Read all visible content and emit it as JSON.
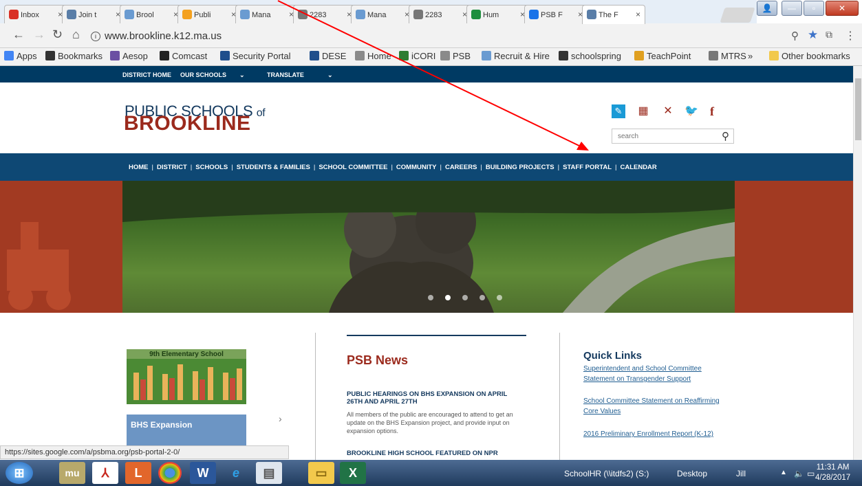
{
  "browser": {
    "tabs": [
      {
        "label": "Inbox",
        "icon": "gmail-icon",
        "color": "#d93025"
      },
      {
        "label": "Join t",
        "icon": "globe-icon",
        "color": "#5a7ea8"
      },
      {
        "label": "Brool",
        "icon": "globe-icon",
        "color": "#6a9bd1"
      },
      {
        "label": "Publi",
        "icon": "star-icon",
        "color": "#f4a11f"
      },
      {
        "label": "Mana",
        "icon": "hire-icon",
        "color": "#6a9bd1"
      },
      {
        "label": "2283",
        "icon": "doc-icon",
        "color": "#777777"
      },
      {
        "label": "Mana",
        "icon": "hire-icon",
        "color": "#6a9bd1"
      },
      {
        "label": "2283",
        "icon": "doc-icon",
        "color": "#777777"
      },
      {
        "label": "Hum",
        "icon": "drive-icon",
        "color": "#1e8e3e"
      },
      {
        "label": "PSB F",
        "icon": "sheet-icon",
        "color": "#1a73e8"
      },
      {
        "label": "The F",
        "icon": "globe-icon",
        "color": "#5a7ea8"
      }
    ],
    "url": "www.brookline.k12.ma.us",
    "bookmarks": [
      {
        "label": "Apps",
        "icon": "apps-icon"
      },
      {
        "label": "Bookmarks",
        "icon": "star-icon"
      },
      {
        "label": "Aesop",
        "icon": "aesop-icon"
      },
      {
        "label": "Comcast",
        "icon": "comcast-icon"
      },
      {
        "label": "Security Portal",
        "icon": "shield-icon"
      },
      {
        "label": "DESE",
        "icon": "shield-icon"
      },
      {
        "label": "Home",
        "icon": "globe-icon"
      },
      {
        "label": "iCORI",
        "icon": "icori-icon"
      },
      {
        "label": "PSB",
        "icon": "globe-icon"
      },
      {
        "label": "Recruit & Hire",
        "icon": "hire-icon"
      },
      {
        "label": "schoolspring",
        "icon": "star-icon"
      },
      {
        "label": "TeachPoint",
        "icon": "teachpoint-icon"
      },
      {
        "label": "MTRS",
        "icon": "mtrs-icon"
      },
      {
        "label": "»",
        "icon": ""
      },
      {
        "label": "Other bookmarks",
        "icon": "folder-icon"
      }
    ],
    "status_url": "https://sites.google.com/a/psbma.org/psb-portal-2-0/"
  },
  "site": {
    "topbar": [
      "DISTRICT HOME",
      "OUR SCHOOLS",
      "TRANSLATE"
    ],
    "logo_line1": "PUBLIC SCHOOLS",
    "logo_of": "of",
    "logo_line2": "BROOKLINE",
    "search_placeholder": "search",
    "nav": [
      "HOME",
      "DISTRICT",
      "SCHOOLS",
      "STUDENTS & FAMILIES",
      "SCHOOL COMMITTEE",
      "COMMUNITY",
      "CAREERS",
      "BUILDING PROJECTS",
      "STAFF PORTAL",
      "CALENDAR"
    ],
    "promos": [
      {
        "label": "9th Elementary School"
      },
      {
        "label": "BHS Expansion"
      }
    ],
    "news": {
      "title": "PSB News",
      "item1_head": "PUBLIC HEARINGS ON BHS EXPANSION ON APRIL 26TH AND APRIL 27TH",
      "item1_body": "All members of the public are encouraged to attend to get an update on the BHS Expansion project, and provide input on expansion options.",
      "item2_head": "BROOKLINE HIGH SCHOOL FEATURED ON NPR"
    },
    "quick_links": {
      "title": "Quick Links",
      "links": [
        "Superintendent and School Committee Statement on Transgender Support",
        "School Committee Statement on Reaffirming Core Values",
        "2016 Preliminary Enrollment Report (K-12)"
      ]
    },
    "carousel_active": 2,
    "carousel_count": 5
  },
  "taskbar": {
    "items": [
      "SchoolHR (\\\\itdfs2) (S:)",
      "Desktop",
      "Jill"
    ],
    "time": "11:31 AM",
    "date": "4/28/2017"
  },
  "annotation": {
    "target": "STAFF PORTAL",
    "color": "#ff0000"
  }
}
